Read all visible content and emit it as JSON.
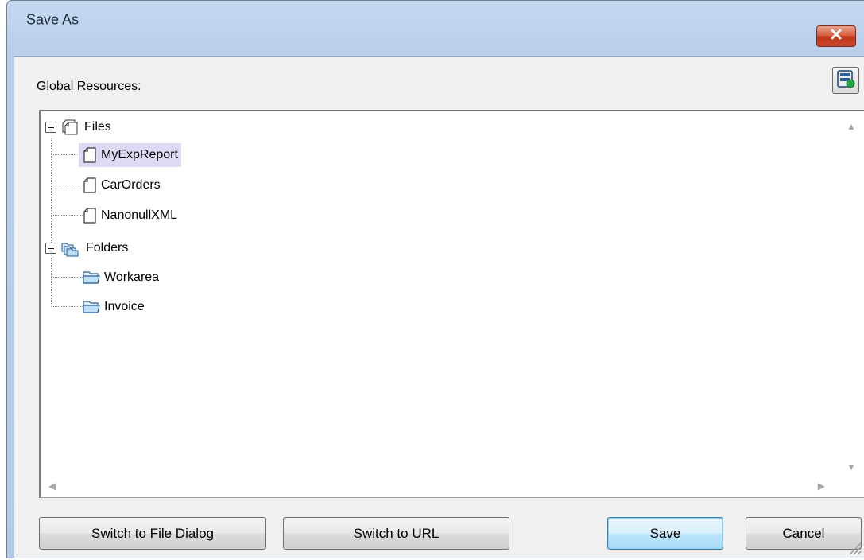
{
  "window": {
    "title": "Save As"
  },
  "global_resources": {
    "label": "Global Resources:"
  },
  "tree": {
    "files": {
      "label": "Files",
      "items": [
        "MyExpReport",
        "CarOrders",
        "NanonullXML"
      ],
      "selected": "MyExpReport"
    },
    "folders": {
      "label": "Folders",
      "items": [
        "Workarea",
        "Invoice"
      ]
    }
  },
  "buttons": {
    "switch_file_dialog": "Switch to File Dialog",
    "switch_url": "Switch to URL",
    "save": "Save",
    "cancel": "Cancel"
  },
  "icons": {
    "close": "close-icon",
    "global_resources": "global-resources-icon",
    "file": "file-icon",
    "files_group": "files-group-icon",
    "folder": "folder-icon",
    "folders_group": "folders-group-icon"
  }
}
